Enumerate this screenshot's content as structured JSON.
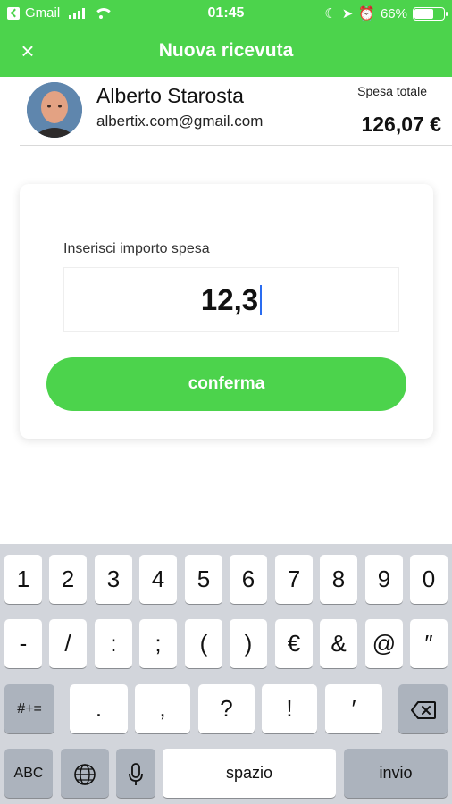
{
  "status_bar": {
    "back_app": "Gmail",
    "time": "01:45",
    "battery": "66%",
    "battery_level": 0.66
  },
  "nav": {
    "title": "Nuova ricevuta",
    "close_glyph": "×"
  },
  "user": {
    "name": "Alberto Starosta",
    "email": "albertix.com@gmail.com",
    "total_label": "Spesa totale",
    "total_value": "126,07 €"
  },
  "form": {
    "label": "Inserisci importo spesa",
    "amount_value": "12,3",
    "confirm_label": "conferma"
  },
  "keyboard": {
    "row1": [
      "1",
      "2",
      "3",
      "4",
      "5",
      "6",
      "7",
      "8",
      "9",
      "0"
    ],
    "row2": [
      "-",
      "/",
      ":",
      ";",
      "(",
      ")",
      "€",
      "&",
      "@",
      "″"
    ],
    "row3": {
      "switch": "#+=",
      "keys": [
        ".",
        ",",
        "?",
        "!",
        "′"
      ]
    },
    "row4": {
      "abc": "ABC",
      "space": "spazio",
      "return": "invio"
    }
  },
  "colors": {
    "brand_green": "#4cd34c",
    "caret_blue": "#2a6cf0"
  }
}
